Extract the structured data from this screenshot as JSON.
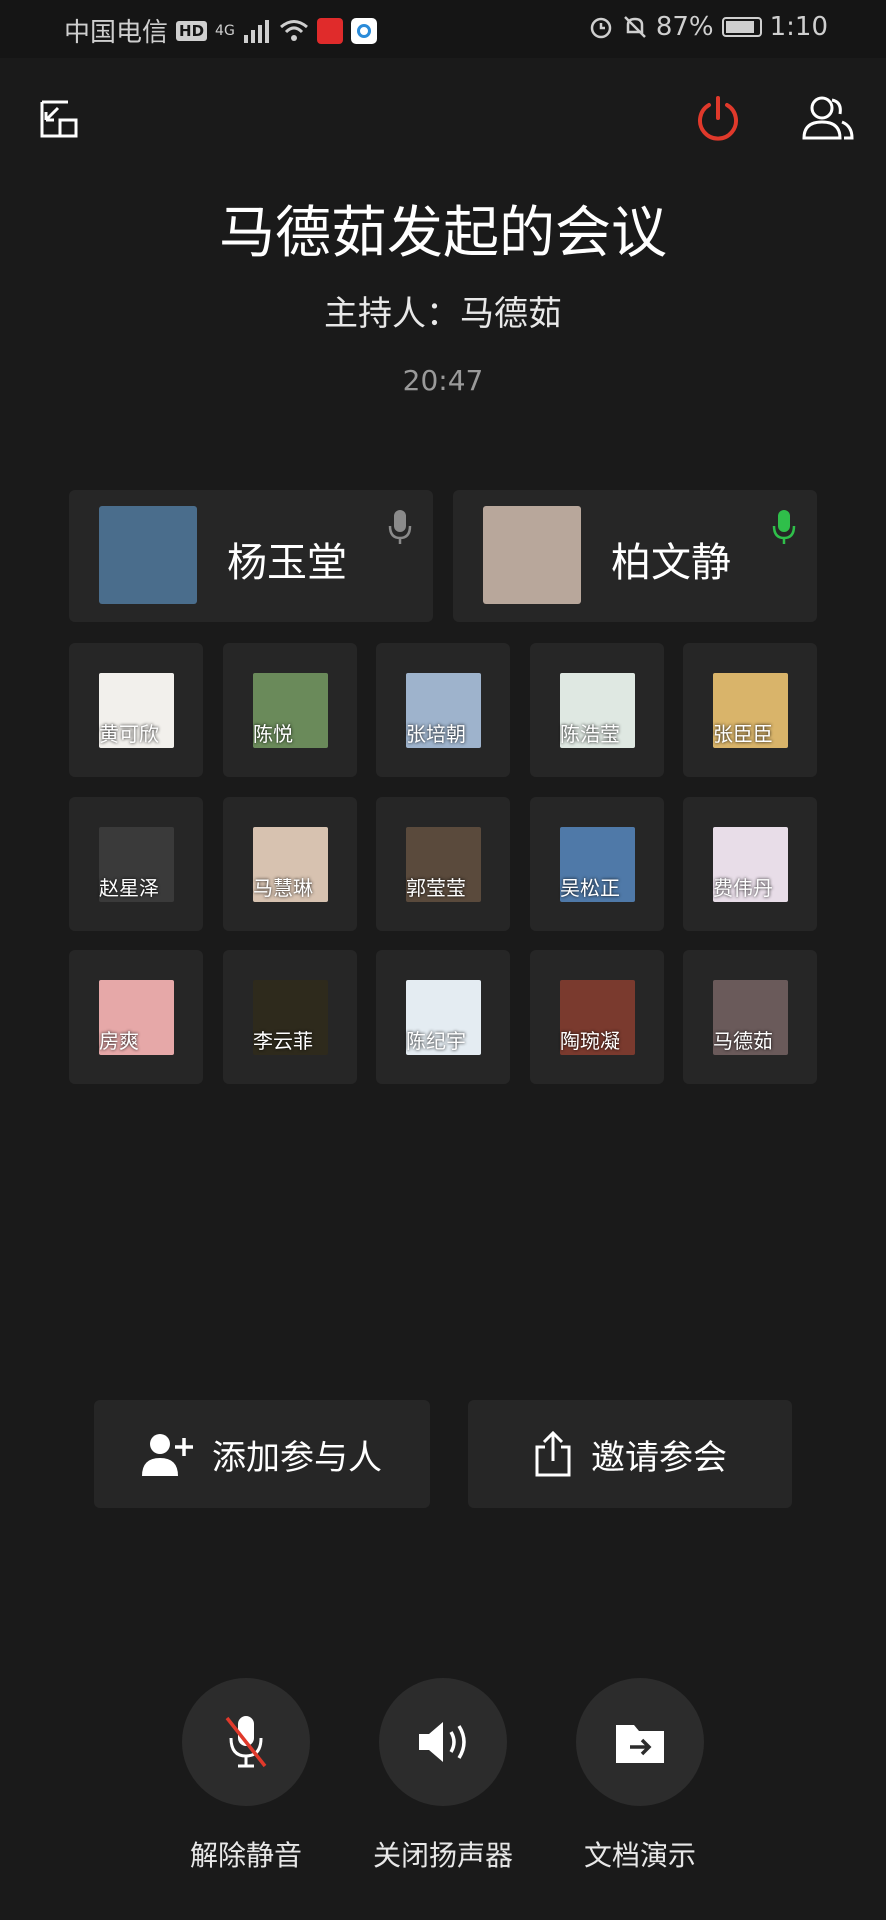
{
  "status": {
    "carrier": "中国电信",
    "hd": "HD",
    "net": "4G",
    "battery": "87%",
    "time": "1:10"
  },
  "meeting": {
    "title": "马德茹发起的会议",
    "host": "主持人：马德茹",
    "duration": "20:47"
  },
  "speakers": [
    {
      "name": "杨玉堂",
      "mic": "muted",
      "avatar_color": "#4a6d8c"
    },
    {
      "name": "柏文静",
      "mic": "active",
      "avatar_color": "#b8a79b"
    }
  ],
  "participants": [
    {
      "name": "黄可欣",
      "avatar_color": "#f2f0ec"
    },
    {
      "name": "陈悦",
      "avatar_color": "#6a8a5a"
    },
    {
      "name": "张培朝",
      "avatar_color": "#9eb3cc"
    },
    {
      "name": "陈浩莹",
      "avatar_color": "#dfe8e2"
    },
    {
      "name": "张臣臣",
      "avatar_color": "#d9b46a"
    },
    {
      "name": "赵星泽",
      "avatar_color": "#3a3a3a"
    },
    {
      "name": "马慧琳",
      "avatar_color": "#d7c2b0"
    },
    {
      "name": "郭莹莹",
      "avatar_color": "#5a4a3c"
    },
    {
      "name": "吴松正",
      "avatar_color": "#4f79a8"
    },
    {
      "name": "费伟丹",
      "avatar_color": "#e8dde8"
    },
    {
      "name": "房爽",
      "avatar_color": "#e6a8a8"
    },
    {
      "name": "李云菲",
      "avatar_color": "#2e2a1c"
    },
    {
      "name": "陈纪宇",
      "avatar_color": "#e4ecf2"
    },
    {
      "name": "陶琬凝",
      "avatar_color": "#7a3a2e"
    },
    {
      "name": "马德茹",
      "avatar_color": "#6a5a5a"
    }
  ],
  "actions": {
    "add": "添加参与人",
    "invite": "邀请参会"
  },
  "controls": {
    "unmute": "解除静音",
    "speaker": "关闭扬声器",
    "share": "文档演示"
  },
  "colors": {
    "background": "#1a1a1a",
    "card": "#262626",
    "hangup": "#e0392b",
    "mic_active": "#2fbf4a"
  }
}
